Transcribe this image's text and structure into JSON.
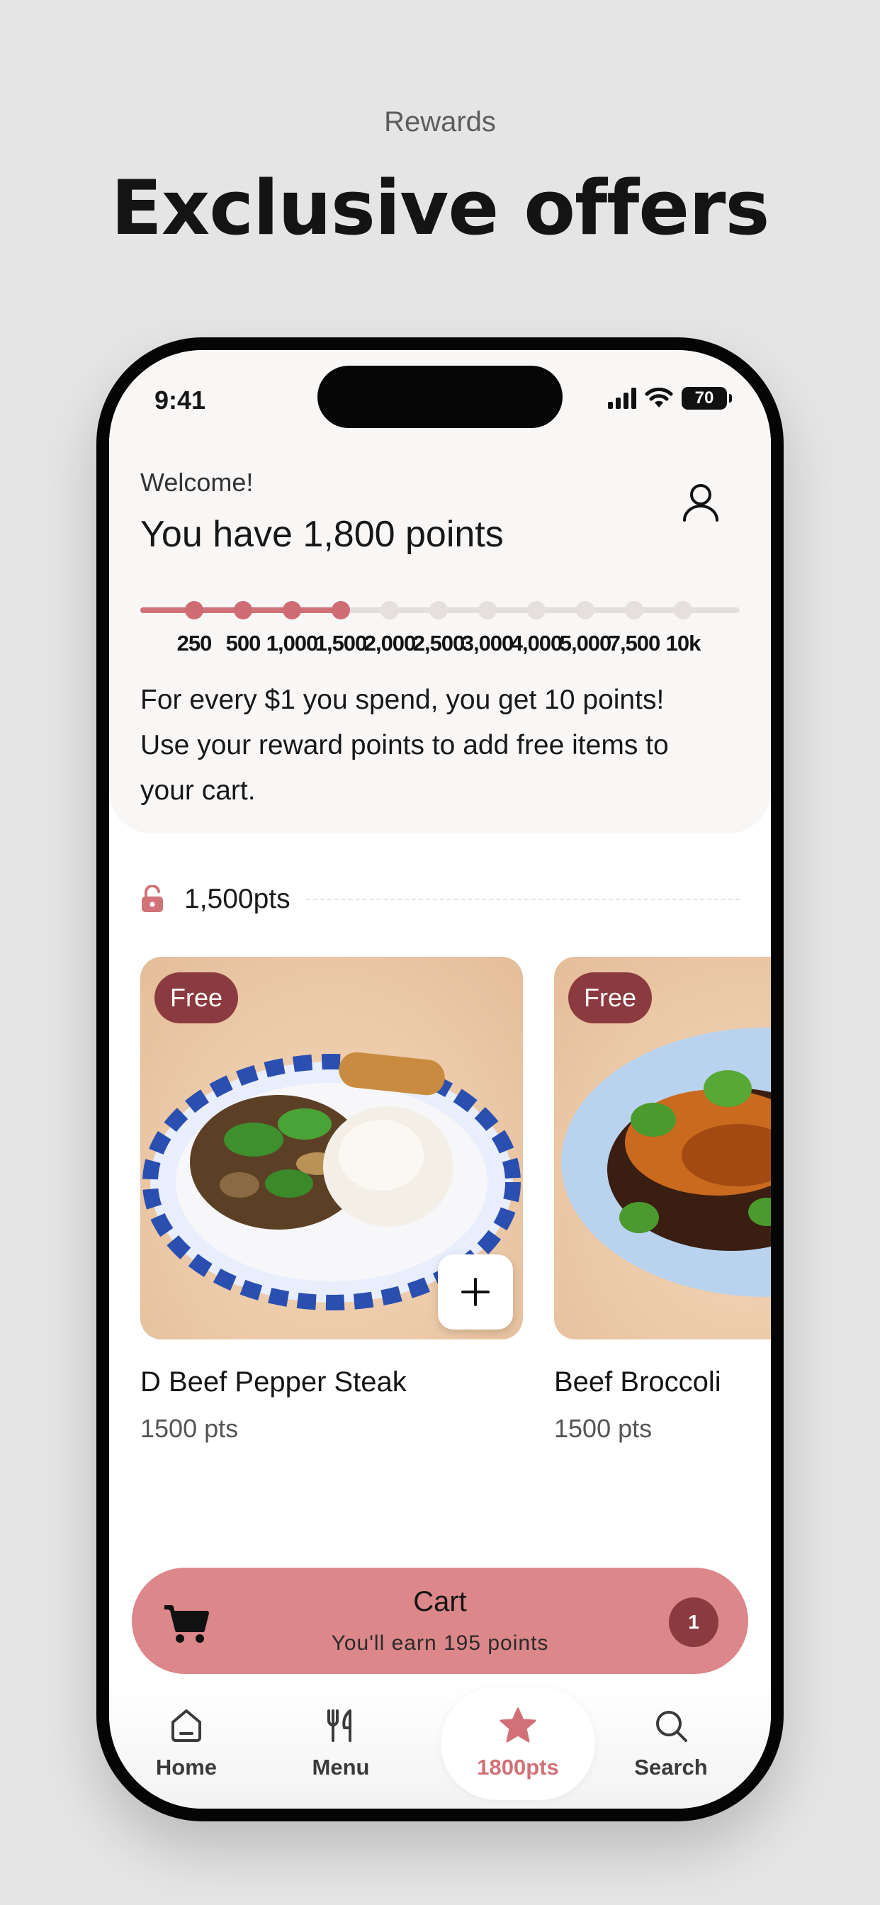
{
  "promo": {
    "kicker": "Rewards",
    "title": "Exclusive offers"
  },
  "status_bar": {
    "time": "9:41",
    "battery": "70"
  },
  "header": {
    "welcome": "Welcome!",
    "points_title": "You have 1,800 points",
    "progress": {
      "current_points": 1800,
      "ticks": [
        "250",
        "500",
        "1,000",
        "1,500",
        "2,000",
        "2,500",
        "3,000",
        "4,000",
        "5,000",
        "7,500",
        "10k"
      ]
    },
    "info_line1": "For every $1 you spend, you get 10 points!",
    "info_line2": "Use your reward points to add free items to",
    "info_line3": "your cart."
  },
  "tier": {
    "label": "1,500pts",
    "icon": "unlock-icon"
  },
  "rewards": [
    {
      "badge": "Free",
      "name": "D Beef Pepper Steak",
      "points": "1500 pts"
    },
    {
      "badge": "Free",
      "name": "Beef Broccoli",
      "points": "1500 pts"
    }
  ],
  "cart": {
    "title": "Cart",
    "subtitle": "You'll earn 195 points",
    "count": "1"
  },
  "tabs": [
    {
      "label": "Home",
      "icon": "home-icon"
    },
    {
      "label": "Menu",
      "icon": "utensils-icon"
    },
    {
      "label": "1800pts",
      "icon": "star-icon",
      "active": true
    },
    {
      "label": "Search",
      "icon": "search-icon"
    }
  ],
  "colors": {
    "accent": "#cf6c73",
    "badge": "#8b3b3f",
    "cart_bar": "#dc878a",
    "background": "#e5e5e6"
  }
}
